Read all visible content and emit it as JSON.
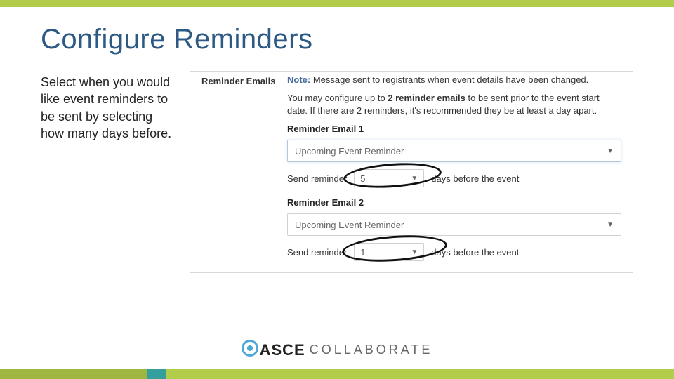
{
  "title": "Configure Reminders",
  "blurb": "Select when you would like event reminders to be sent by selecting how many days before.",
  "panel": {
    "sideLabel": "Reminder Emails",
    "noteLabel": "Note:",
    "noteText": "Message sent to registrants when event details have been changed.",
    "infoPrefix": "You may configure up to ",
    "infoBold": "2 reminder emails",
    "infoSuffix": " to be sent prior to the event start date. If there are 2 reminders, it's recommended they be at least a day apart.",
    "r1": {
      "head": "Reminder Email 1",
      "template": "Upcoming Event Reminder",
      "sendLabel": "Send reminder",
      "days": "5",
      "after": "days before the event"
    },
    "r2": {
      "head": "Reminder Email 2",
      "template": "Upcoming Event Reminder",
      "sendLabel": "Send reminder",
      "days": "1",
      "after": "days before the event"
    }
  },
  "logo": {
    "brand": "ASCE",
    "sub": "COLLABORATE"
  }
}
